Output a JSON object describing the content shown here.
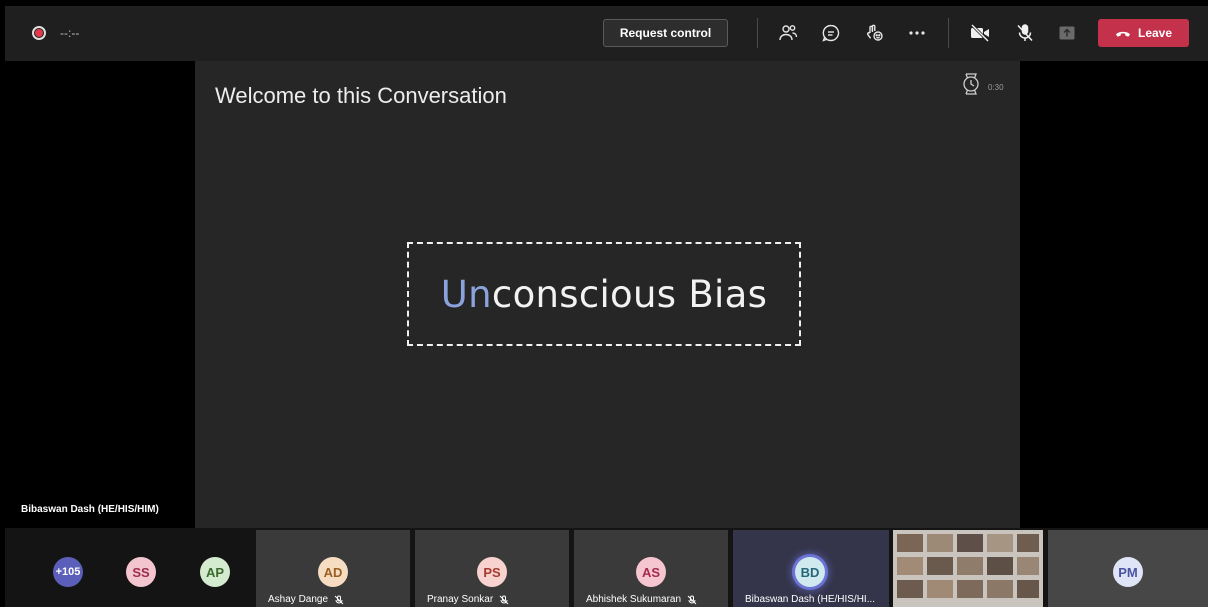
{
  "meeting": {
    "timer": "--:--",
    "request_control_label": "Request control",
    "leave_label": "Leave",
    "colors": {
      "leave": "#c4314b",
      "record": "#e23a4a",
      "accent": "#6b73d6"
    }
  },
  "toolbar_icons": [
    "participants-icon",
    "chat-icon",
    "reactions-icon",
    "more-icon",
    "camera-off-icon",
    "mic-off-icon",
    "share-icon"
  ],
  "slide": {
    "title": "Welcome to this Conversation",
    "clock_label": "0:30",
    "main_text_highlight": "Un",
    "main_text_rest": "conscious Bias"
  },
  "presenter_name": "Bibaswan Dash (HE/HIS/HIM)",
  "participants": {
    "overflow": "+105",
    "tiles": [
      {
        "initials": "SS"
      },
      {
        "initials": "AP"
      },
      {
        "initials": "AD",
        "name": "Ashay Dange"
      },
      {
        "initials": "PS",
        "name": "Pranay Sonkar"
      },
      {
        "initials": "AS",
        "name": "Abhishek Sukumaran"
      },
      {
        "initials": "BD",
        "name": "Bibaswan Dash (HE/HIS/HI..."
      },
      {
        "initials": "PM"
      }
    ]
  }
}
